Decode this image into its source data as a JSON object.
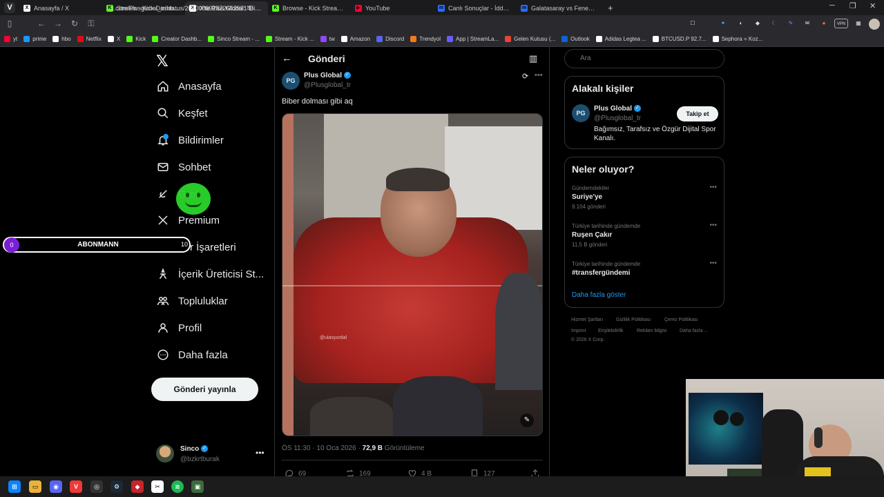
{
  "browser": {
    "tabs": [
      {
        "label": "Anasayfa / X",
        "favicon": "X",
        "color": "#ffffff",
        "badge": "4"
      },
      {
        "label": "Stream - Kick Dashboard",
        "favicon": "K",
        "color": "#53fc18"
      },
      {
        "label": "X'te Plus Global: \"Biber dol...",
        "favicon": "X",
        "color": "#ffffff"
      },
      {
        "label": "Browse - Kick Streaming",
        "favicon": "K",
        "color": "#53fc18"
      },
      {
        "label": "YouTube",
        "favicon": "▶",
        "color": "#ff0033"
      },
      {
        "label": "Canlı Sonuçlar - İddaa Sonu...",
        "favicon": "m",
        "color": "#2b6cff"
      },
      {
        "label": "Galatasaray vs Fenerbahçe",
        "favicon": "m",
        "color": "#2b6cff"
      }
    ],
    "new_tab": "+",
    "url": "x.com/Plusglobal_tr/status/2010086918726529214",
    "bookmarks": [
      {
        "label": "yt",
        "color": "#ff0033"
      },
      {
        "label": "prime",
        "color": "#1a98ff"
      },
      {
        "label": "hbo",
        "color": "#ffffff"
      },
      {
        "label": "Netflix",
        "color": "#e50914"
      },
      {
        "label": "X",
        "color": "#ffffff"
      },
      {
        "label": "Kick",
        "color": "#53fc18"
      },
      {
        "label": "Creator Dashb...",
        "color": "#53fc18"
      },
      {
        "label": "Sinco Stream - ...",
        "color": "#53fc18"
      },
      {
        "label": "Stream - Kick ...",
        "color": "#53fc18"
      },
      {
        "label": "tw",
        "color": "#9146ff"
      },
      {
        "label": "Amazon",
        "color": "#ffffff"
      },
      {
        "label": "Discord",
        "color": "#5865f2"
      },
      {
        "label": "Trendyol",
        "color": "#f27a1a"
      },
      {
        "label": "App | StreamLa...",
        "color": "#6b5cff"
      },
      {
        "label": "Gelen Kutusu (...",
        "color": "#ea4335"
      },
      {
        "label": "Outlook",
        "color": "#0a64d6"
      },
      {
        "label": "Adidas Legtea ...",
        "color": "#ffffff"
      },
      {
        "label": "BTCUSD.P 92.7...",
        "color": "#ffffff"
      },
      {
        "label": "Sephora = Koz...",
        "color": "#ffffff"
      }
    ]
  },
  "nav": {
    "items": [
      {
        "label": "Anasayfa",
        "icon": "home-icon"
      },
      {
        "label": "Keşfet",
        "icon": "search-icon"
      },
      {
        "label": "Bildirimler",
        "icon": "bell-icon"
      },
      {
        "label": "Sohbet",
        "icon": "mail-icon"
      },
      {
        "label": "Grok",
        "icon": "grok-icon"
      },
      {
        "label": "Premium",
        "icon": "x-icon"
      },
      {
        "label": "Yer İşaretleri",
        "icon": "bookmark-icon"
      },
      {
        "label": "İçerik Üreticisi St...",
        "icon": "creator-icon"
      },
      {
        "label": "Topluluklar",
        "icon": "communities-icon"
      },
      {
        "label": "Profil",
        "icon": "profile-icon"
      },
      {
        "label": "Daha fazla",
        "icon": "more-icon"
      }
    ],
    "post_button": "Gönderi yayınla",
    "user": {
      "name": "Sinco",
      "handle": "@bzkrtburak"
    }
  },
  "overlay": {
    "sub_count": "0",
    "sub_label": "ABONMANN",
    "sub_goal": "10"
  },
  "post": {
    "header": "Gönderi",
    "author": "Plus Global",
    "handle": "@Plusglobal_tr",
    "text": "Biber dolması gibi aq",
    "watermark": "@ulasyurdal",
    "meta_time": "ÖS 11:30 · 10 Oca 2026 · ",
    "views": "72,9 B",
    "views_label": " Görüntüleme",
    "replies": "69",
    "reposts": "169",
    "likes": "4 B",
    "bookmarks": "127"
  },
  "sidebar": {
    "search_placeholder": "Ara",
    "related_title": "Alakalı kişiler",
    "related": {
      "name": "Plus Global",
      "handle": "@Plusglobal_tr",
      "bio": "Bağımsız, Tarafsız ve Özgür Dijital Spor Kanalı.",
      "follow": "Takip et"
    },
    "trends_title": "Neler oluyor?",
    "trends": [
      {
        "category": "Gündemdekiler",
        "name": "Suriye'ye",
        "count": "9.104 gönderi"
      },
      {
        "category": "Türkiye tarihinde gündemde",
        "name": "Ruşen Çakır",
        "count": "11,5 B gönderi"
      },
      {
        "category": "Türkiye tarihinde gündemde",
        "name": "#transfergündemi",
        "count": ""
      }
    ],
    "show_more": "Daha fazla göster",
    "footer": [
      "Hizmet Şartları",
      "Gizlilik Politikası",
      "Çerez Politikası",
      "Imprint",
      "Erişilebilirlik",
      "Reklam bilgisi",
      "Daha fazla ...",
      "© 2026 X Corp."
    ]
  },
  "colors": {
    "accent": "#1d9bf0",
    "verified": "#1d9bf0",
    "background": "#000000"
  }
}
